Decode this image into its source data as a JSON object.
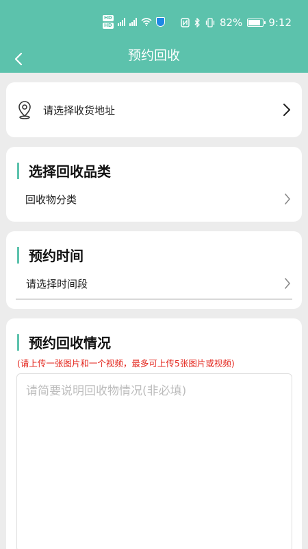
{
  "status_bar": {
    "battery": "82%",
    "time": "9:12",
    "battery_level": 0.82
  },
  "header": {
    "title": "预约回收"
  },
  "address": {
    "placeholder": "请选择收货地址"
  },
  "category": {
    "title": "选择回收品类",
    "placeholder": "回收物分类"
  },
  "time": {
    "title": "预约时间",
    "placeholder": "请选择时间段"
  },
  "description": {
    "title": "预约回收情况",
    "note": "(请上传一张图片和一个视频，最多可上传5张图片或视频)",
    "placeholder": "请简要说明回收物情况(非必填)"
  },
  "colors": {
    "accent": "#5cc2ac",
    "warning_text": "#e3241b",
    "background": "#ececec"
  }
}
